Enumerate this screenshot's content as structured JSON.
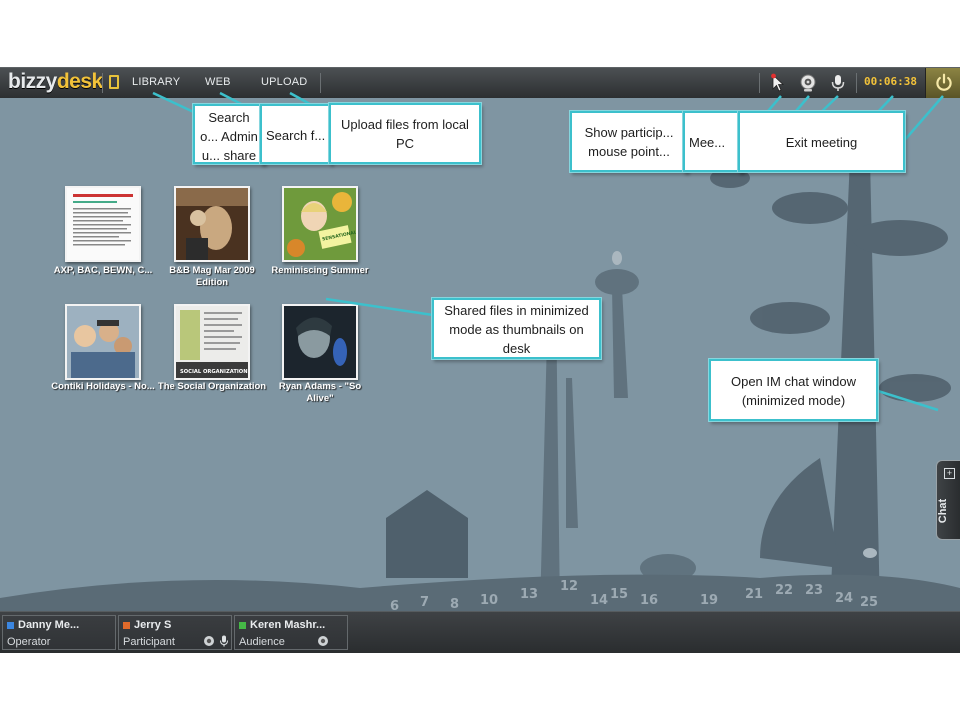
{
  "app": {
    "logo_text": "bizzy",
    "logo_accent": "desk",
    "nav": [
      {
        "label": "LIBRARY"
      },
      {
        "label": "WEB"
      },
      {
        "label": "UPLOAD"
      }
    ],
    "timer": "00:06:38"
  },
  "icons": {
    "file": "file-icon",
    "pointer": "pointer-icon",
    "webcam": "webcam-icon",
    "microphone": "microphone-icon",
    "power": "power-icon",
    "chat_expand": "plus-icon"
  },
  "desk": {
    "files": [
      {
        "caption": "AXP, BAC, BEWN, C..."
      },
      {
        "caption": "B&B Mag Mar 2009 Edition"
      },
      {
        "caption": "Reminiscing Summer"
      },
      {
        "caption": "Contiki Holidays - No..."
      },
      {
        "caption": "The Social Organization"
      },
      {
        "caption": "Ryan Adams - \"So Alive\""
      }
    ],
    "thumb_text": {
      "summer_badge": "SENSATIONAL SUMMER!",
      "social_banner": "SOCIAL ORGANIZATION"
    },
    "chat_tab": {
      "label": "Chat",
      "plus": "+"
    }
  },
  "participants": [
    {
      "name": "Danny Me...",
      "role": "Operator",
      "color": "#3b86e0"
    },
    {
      "name": "Jerry S",
      "role": "Participant",
      "color": "#e06a2b"
    },
    {
      "name": "Keren Mashr...",
      "role": "Audience",
      "color": "#45b846"
    }
  ],
  "callouts": {
    "search_library": "Search o... Admin u... share in...",
    "search_web": "Search f...",
    "upload": "Upload files from local PC",
    "show_pointer": "Show particip... mouse point...",
    "meeting": "Mee...",
    "exit": "Exit meeting",
    "shared_files": "Shared files in minimized mode as thumbnails on desk",
    "im_chat": "Open IM chat window (minimized mode)"
  },
  "colors": {
    "accent": "#f2c23a",
    "callout_border": "#3cc0cc",
    "desk_background": "#7f95a2",
    "toolbar": "#3a3d40"
  }
}
